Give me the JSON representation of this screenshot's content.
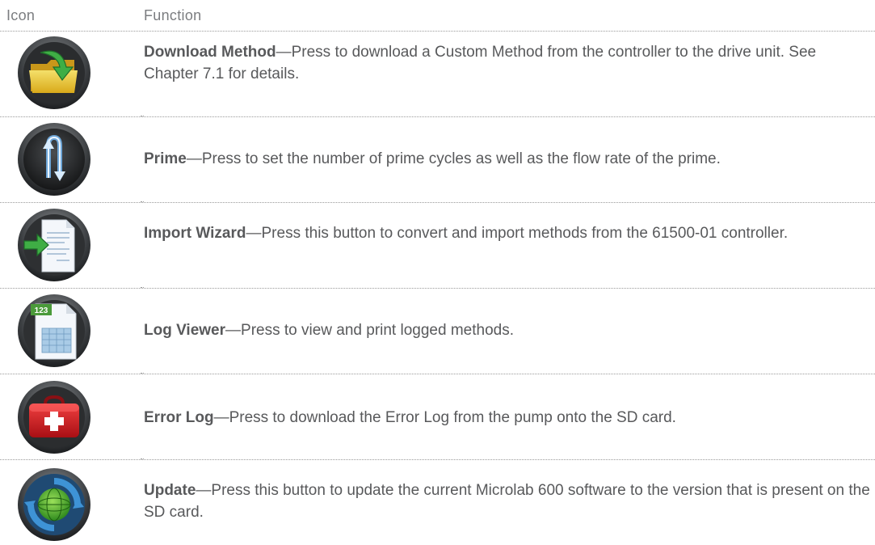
{
  "header": {
    "icon_col": "Icon",
    "function_col": "Function"
  },
  "separator": "—",
  "rows": [
    {
      "icon": "download-folder-icon",
      "title": "Download Method",
      "text": "Press to download a Custom Method from the controller to the drive unit. See Chapter 7.1 for details."
    },
    {
      "icon": "prime-cycle-icon",
      "title": "Prime",
      "text": "Press to set the number of prime cycles as well as the flow rate of the prime."
    },
    {
      "icon": "import-document-icon",
      "title": "Import Wizard",
      "text": "Press this button to convert and import methods from the 61500-01 controller."
    },
    {
      "icon": "log-spreadsheet-icon",
      "title": "Log Viewer",
      "badge": "123",
      "text": "Press to view and print logged methods."
    },
    {
      "icon": "first-aid-kit-icon",
      "title": "Error Log",
      "text": "Press to download the Error Log from the pump onto the SD card."
    },
    {
      "icon": "update-globe-icon",
      "title": "Update",
      "text": "Press this button to update the current Microlab 600 software to the version that is present on the SD card."
    }
  ]
}
